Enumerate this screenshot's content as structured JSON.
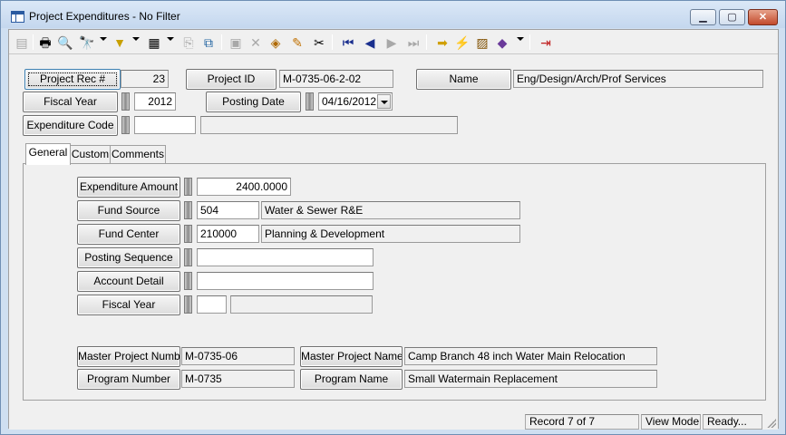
{
  "window": {
    "title": "Project Expenditures - No Filter",
    "minimize": "▁",
    "maximize": "▢",
    "close": "✕"
  },
  "toolbar": {
    "icons": [
      "new-record-icon",
      "print-icon",
      "print-preview-icon",
      "find-icon",
      "filter-icon",
      "view-icon",
      "copy-icon",
      "export-icon",
      "save-icon",
      "delete-icon",
      "undo-icon",
      "edit-icon",
      "cut-icon",
      "first-record-icon",
      "previous-record-icon",
      "next-record-icon",
      "last-record-icon",
      "go-to-icon",
      "run-icon",
      "report-icon",
      "book-icon",
      "exit-icon"
    ]
  },
  "header": {
    "project_rec_label": "Project Rec #",
    "project_rec_value": "23",
    "project_id_label": "Project ID",
    "project_id_value": "M-0735-06-2-02",
    "name_label": "Name",
    "name_value": "Eng/Design/Arch/Prof Services",
    "fiscal_year_label": "Fiscal Year",
    "fiscal_year_value": "2012",
    "posting_date_label": "Posting Date",
    "posting_date_value": "04/16/2012",
    "expenditure_code_label": "Expenditure Code",
    "expenditure_code_value": "",
    "expenditure_code_desc": ""
  },
  "tabs": [
    {
      "label": "General"
    },
    {
      "label": "Custom"
    },
    {
      "label": "Comments"
    }
  ],
  "general": {
    "expenditure_amount_label": "Expenditure Amount",
    "expenditure_amount_value": "2400.0000",
    "fund_source_label": "Fund Source",
    "fund_source_code": "504",
    "fund_source_desc": "Water & Sewer R&E",
    "fund_center_label": "Fund Center",
    "fund_center_code": "210000",
    "fund_center_desc": "Planning & Development",
    "posting_sequence_label": "Posting Sequence",
    "posting_sequence_value": "",
    "account_detail_label": "Account Detail",
    "account_detail_value": "",
    "fiscal_year_label": "Fiscal Year",
    "fiscal_year_value": "",
    "fiscal_year_desc": "",
    "master_project_number_label": "Master Project Number",
    "master_project_number_value": "M-0735-06",
    "master_project_name_label": "Master Project Name",
    "master_project_name_value": "Camp Branch 48 inch Water Main Relocation",
    "program_number_label": "Program Number",
    "program_number_value": "M-0735",
    "program_name_label": "Program Name",
    "program_name_value": "Small Watermain Replacement"
  },
  "status": {
    "record": "Record 7 of 7",
    "mode": "View Mode",
    "state": "Ready..."
  }
}
